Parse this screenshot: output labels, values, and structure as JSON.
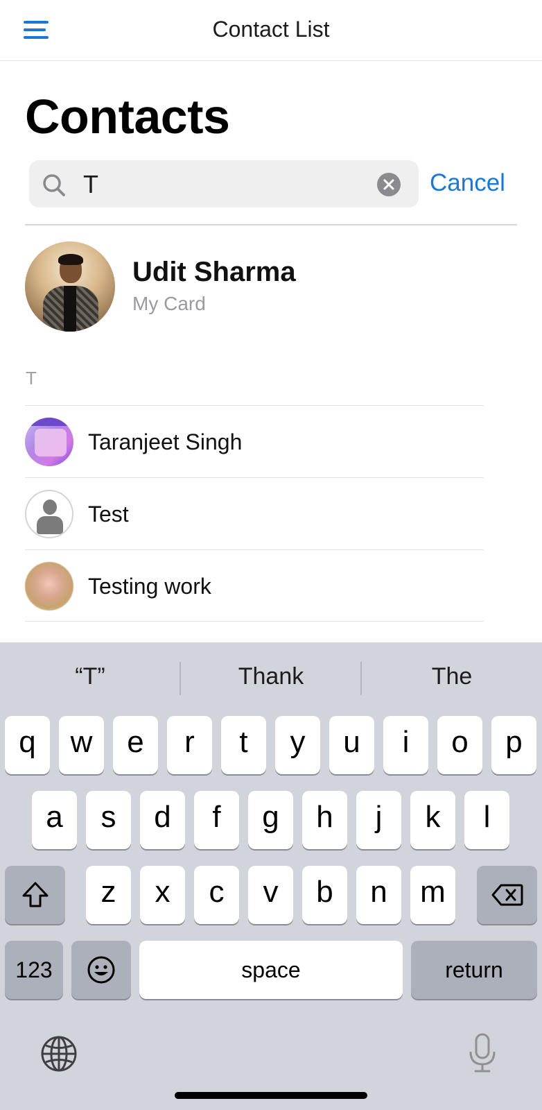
{
  "nav": {
    "title": "Contact List"
  },
  "page_title": "Contacts",
  "search": {
    "value": "T",
    "cancel_label": "Cancel"
  },
  "my_card": {
    "name": "Udit Sharma",
    "subtitle": "My Card"
  },
  "section": {
    "letter": "T"
  },
  "contacts": [
    {
      "name": "Taranjeet Singh"
    },
    {
      "name": "Test"
    },
    {
      "name": "Testing work"
    }
  ],
  "keyboard": {
    "suggestions": [
      "“T”",
      "Thank",
      "The"
    ],
    "row1": [
      "q",
      "w",
      "e",
      "r",
      "t",
      "y",
      "u",
      "i",
      "o",
      "p"
    ],
    "row2": [
      "a",
      "s",
      "d",
      "f",
      "g",
      "h",
      "j",
      "k",
      "l"
    ],
    "row3": [
      "z",
      "x",
      "c",
      "v",
      "b",
      "n",
      "m"
    ],
    "numbers_label": "123",
    "space_label": "space",
    "return_label": "return"
  },
  "colors": {
    "accent": "#1a78d6",
    "keyboard_bg": "#d1d4db",
    "dark_key": "#abb0ba"
  }
}
